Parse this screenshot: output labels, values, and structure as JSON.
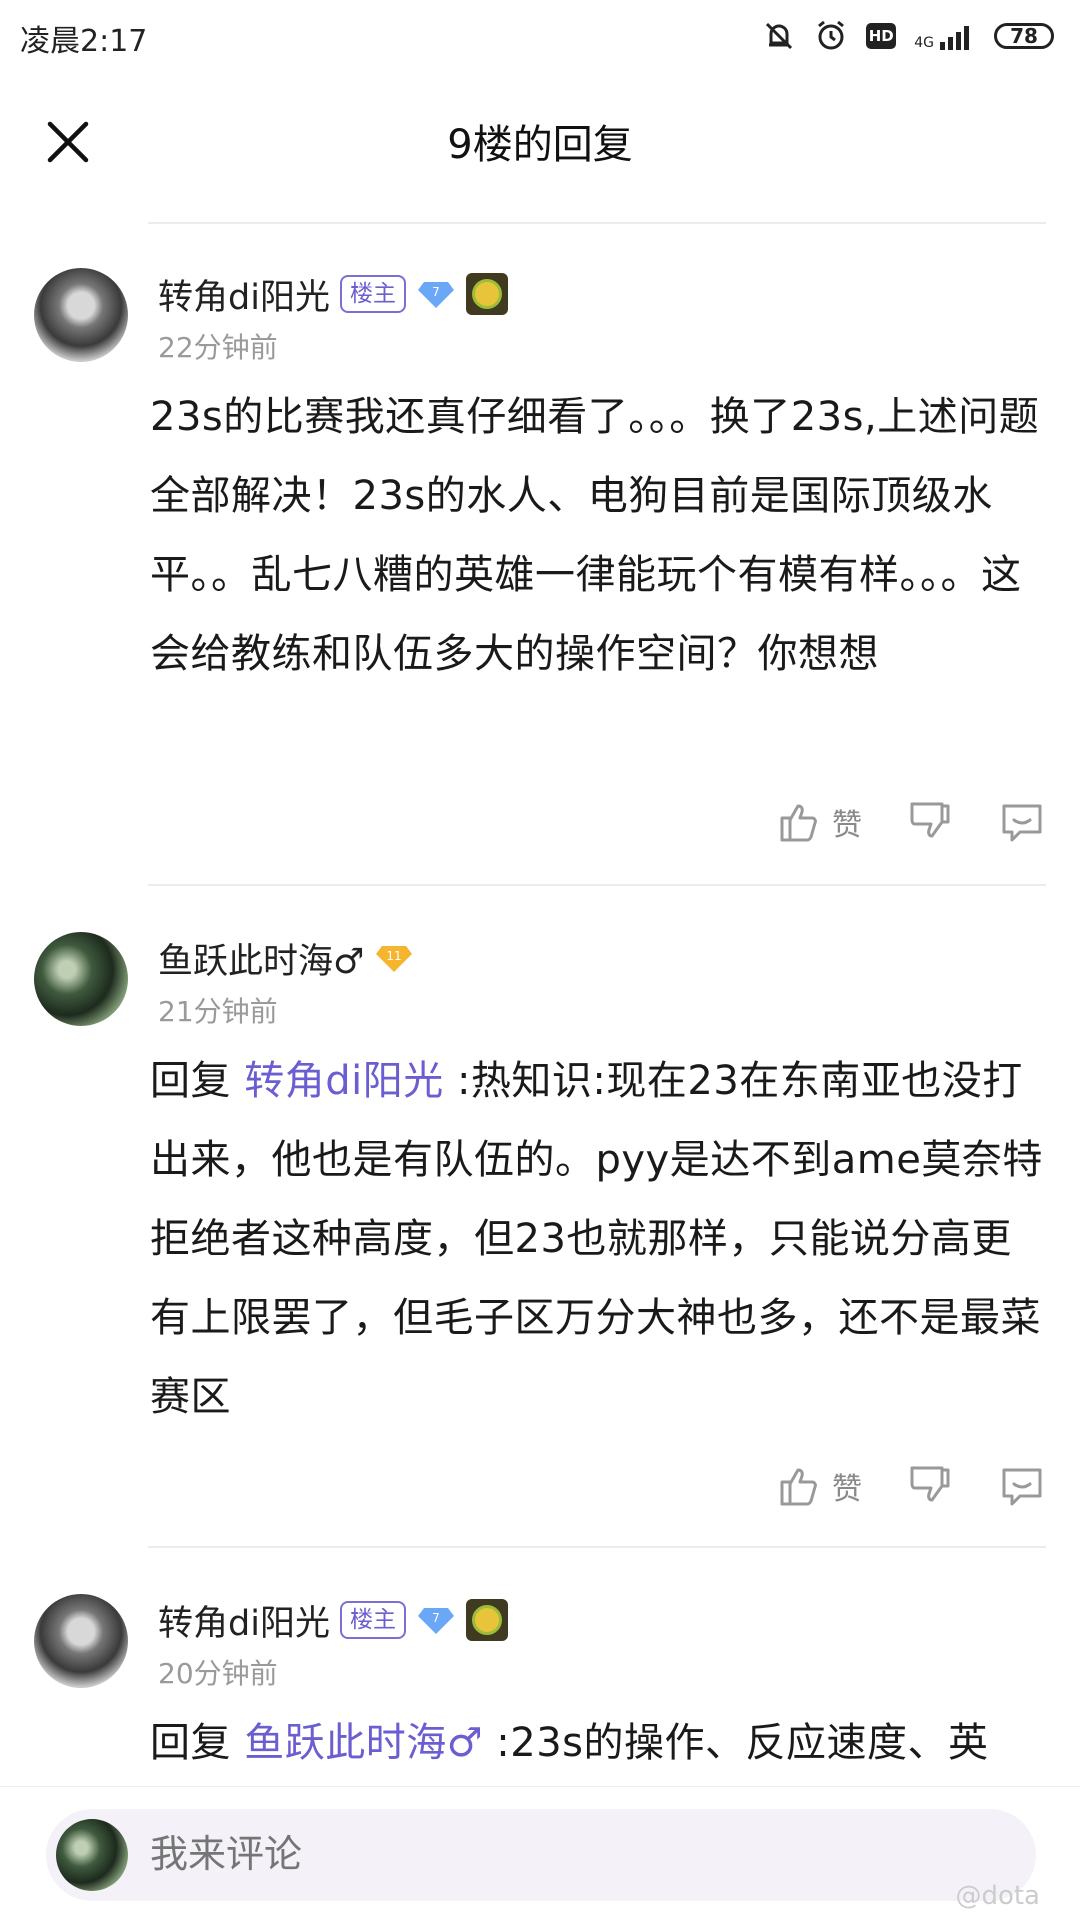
{
  "status_bar": {
    "time": "凌晨2:17",
    "hd": "HD",
    "network": "4G",
    "battery": "78"
  },
  "header": {
    "title": "9楼的回复"
  },
  "comments": [
    {
      "username": "转角di阳光",
      "owner_badge": "楼主",
      "level": "7",
      "time": "22分钟前",
      "text": "23s的比赛我还真仔细看了。。。换了23s,上述问题全部解决！23s的水人、电狗目前是国际顶级水平。。乱七八糟的英雄一律能玩个有模有样。。。这会给教练和队伍多大的操作空间？你想想",
      "like_label": "赞"
    },
    {
      "username": "鱼跃此时海♂",
      "level": "11",
      "time": "21分钟前",
      "reply_prefix": "回复 ",
      "reply_to": "转角di阳光",
      "text": " :热知识:现在23在东南亚也没打出来，他也是有队伍的。pyy是达不到ame莫奈特拒绝者这种高度，但23也就那样，只能说分高更有上限罢了，但毛子区万分大神也多，还不是最菜赛区",
      "like_label": "赞"
    },
    {
      "username": "转角di阳光",
      "owner_badge": "楼主",
      "level": "7",
      "time": "20分钟前",
      "reply_prefix": "回复 ",
      "reply_to": "鱼跃此时海♂",
      "text": " :23s的操作、反应速度、英"
    }
  ],
  "bottom": {
    "placeholder": "我来评论",
    "watermark": "@dota"
  },
  "colors": {
    "accent": "#6a5ed0",
    "muted": "#9a9a9a",
    "divider": "#ececec",
    "input_bg": "#f4f2f8"
  },
  "icons": [
    "close-icon",
    "thumb-up-icon",
    "thumb-down-icon",
    "reply-icon",
    "gem-icon",
    "medal-icon"
  ]
}
